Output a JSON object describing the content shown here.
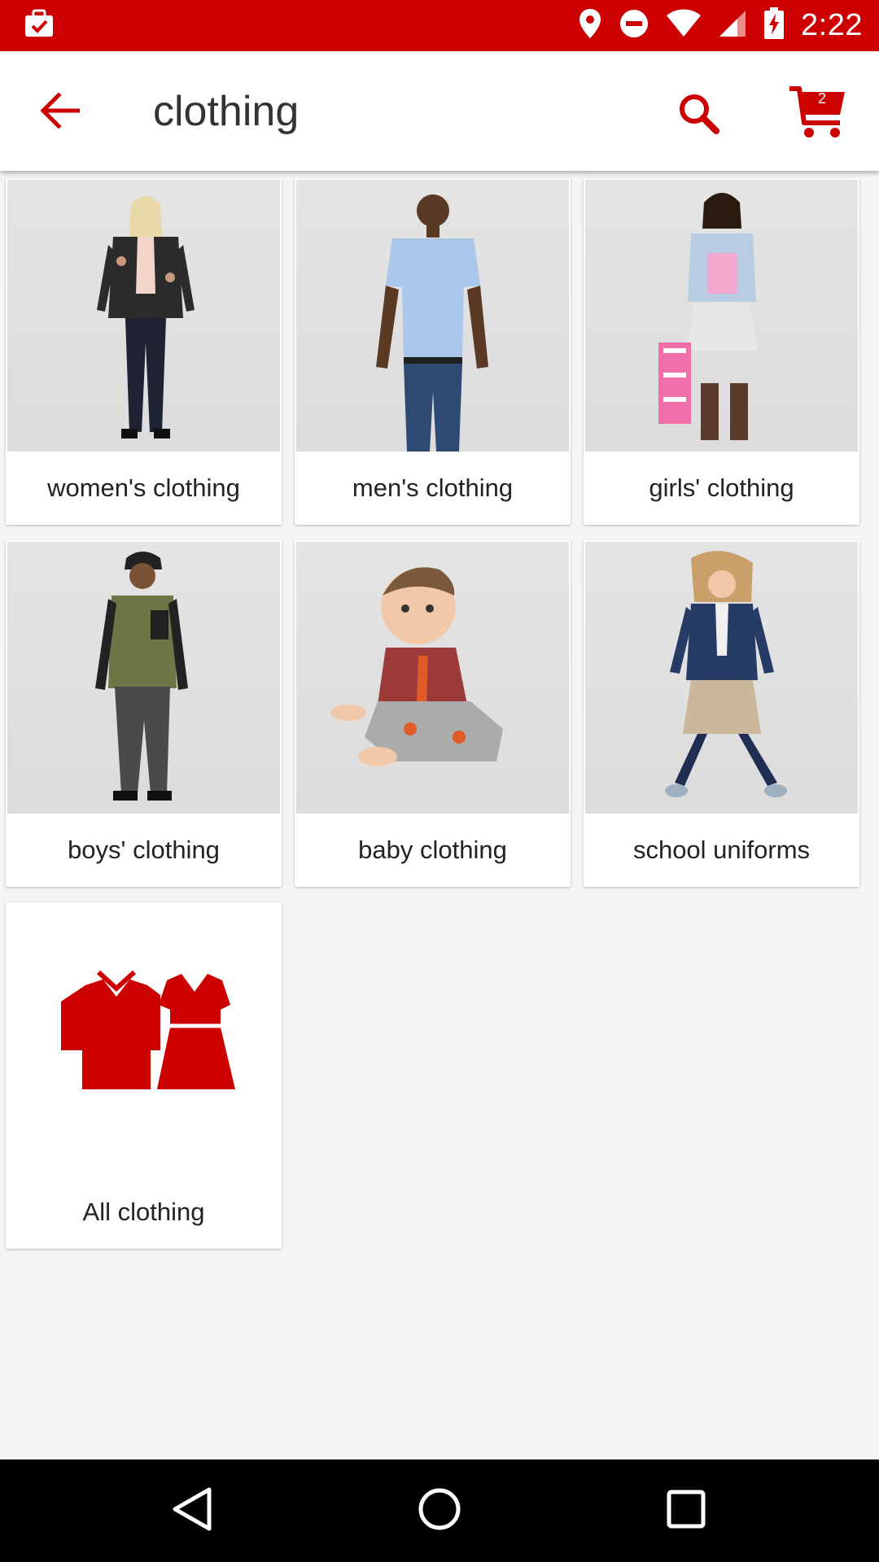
{
  "status_bar": {
    "time": "2:22",
    "icons": [
      "briefcase-check-icon",
      "location-icon",
      "do-not-disturb-icon",
      "wifi-icon",
      "signal-icon",
      "battery-charging-icon"
    ]
  },
  "app_bar": {
    "title": "clothing",
    "back_icon": "arrow-back-icon",
    "search_icon": "search-icon",
    "cart_icon": "cart-icon",
    "cart_count": "2"
  },
  "categories": [
    {
      "label": "women's clothing",
      "image": "woman-model-photo"
    },
    {
      "label": "men's clothing",
      "image": "man-model-photo"
    },
    {
      "label": "girls' clothing",
      "image": "girl-model-photo"
    },
    {
      "label": "boys' clothing",
      "image": "boy-model-photo"
    },
    {
      "label": "baby clothing",
      "image": "baby-model-photo"
    },
    {
      "label": "school uniforms",
      "image": "school-uniform-model-photo"
    },
    {
      "label": "All clothing",
      "image": "clothing-icon"
    }
  ],
  "nav_bar": {
    "icons": [
      "back-triangle-icon",
      "home-circle-icon",
      "recents-square-icon"
    ]
  },
  "colors": {
    "brand_red": "#cc0000",
    "background": "#f5f5f5",
    "text_dark": "#222222"
  }
}
